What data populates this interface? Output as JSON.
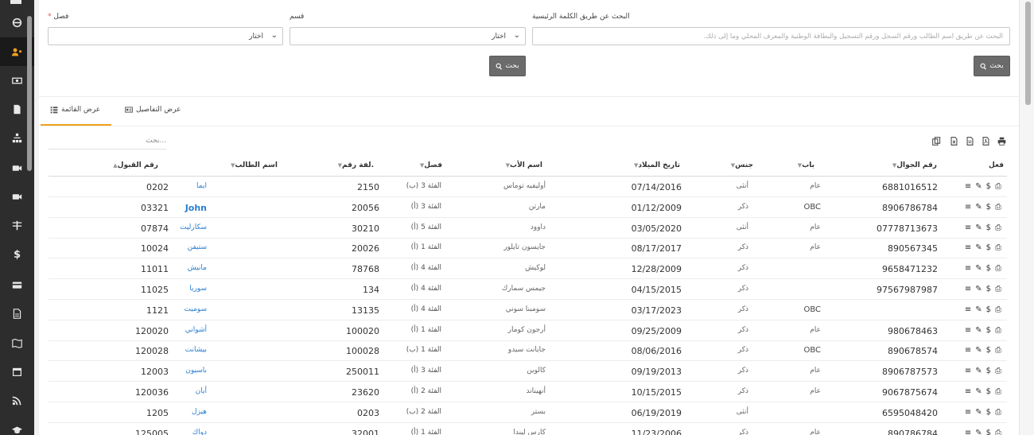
{
  "filters": {
    "class_label": "فصل",
    "required_mark": "*",
    "class_select": "اختار",
    "section_label": "قسم",
    "section_select": "اختار",
    "keyword_label": "البحث عن طريق الكلمة الرئيسية",
    "keyword_placeholder": "البحث عن طريق اسم الطالب ورقم السجل ورقم التسجيل والبطاقة الوطنية والمعرف المحلي وما إلى ذلك.",
    "search_button": "بحث"
  },
  "tabs": [
    {
      "label": "عرض القائمة",
      "icon": "list-icon",
      "active": true
    },
    {
      "label": "عرض التفاصيل",
      "icon": "id-card-icon",
      "active": false
    }
  ],
  "table_search_placeholder": "بحث...",
  "toolbar_icons": [
    "print-icon",
    "pdf-icon",
    "csv-icon",
    "excel-icon",
    "copy-icon"
  ],
  "columns": [
    "فعل",
    "رقم الجوال",
    "باب",
    "جنس",
    "تاريخ الميلاد",
    "اسم الأب",
    "فصل",
    "لفة رقم.",
    "اسم الطالب",
    "رقم القبول"
  ],
  "action_glyphs": {
    "menu": "≡",
    "edit": "✎",
    "fees": "$",
    "print": "⎙"
  },
  "rows": [
    {
      "mobile": "6881016512",
      "section": "عام",
      "gender": "أنثى",
      "dob": "07/14/2016",
      "father": "أوليفيه توماس",
      "class": "الفئة 3 (ب)",
      "roll": "2150",
      "name": "ايما",
      "admission": "0202"
    },
    {
      "mobile": "8906786784",
      "section": "OBC",
      "gender": "ذكر",
      "dob": "01/12/2009",
      "father": "مارتن",
      "class": "الفئة 3 (أ)",
      "roll": "20056",
      "name": "John",
      "admission": "03321"
    },
    {
      "mobile": "07778713673",
      "section": "عام",
      "gender": "أنثى",
      "dob": "03/05/2020",
      "father": "داوود",
      "class": "الفئة 5 (أ)",
      "roll": "30210",
      "name": "سكارليت",
      "admission": "07874"
    },
    {
      "mobile": "890567345",
      "section": "عام",
      "gender": "ذكر",
      "dob": "08/17/2017",
      "father": "جايسون تايلور",
      "class": "الفئة 1 (أ)",
      "roll": "20026",
      "name": "ستيفن",
      "admission": "10024"
    },
    {
      "mobile": "9658471232",
      "section": "",
      "gender": "ذكر",
      "dob": "12/28/2009",
      "father": "لوكيش",
      "class": "الفئة 4 (أ)",
      "roll": "78768",
      "name": "مانيش",
      "admission": "11011"
    },
    {
      "mobile": "97567987987",
      "section": "",
      "gender": "ذكر",
      "dob": "04/15/2015",
      "father": "جيمس سمارك",
      "class": "الفئة 4 (أ)",
      "roll": "134",
      "name": "سوريا",
      "admission": "11025"
    },
    {
      "mobile": "",
      "section": "OBC",
      "gender": "ذكر",
      "dob": "03/17/2023",
      "father": "سومبنا سوني",
      "class": "الفئة 4 (أ)",
      "roll": "13135",
      "name": "سوميت",
      "admission": "1121"
    },
    {
      "mobile": "980678463",
      "section": "عام",
      "gender": "ذكر",
      "dob": "09/25/2009",
      "father": "أرجون كومار",
      "class": "الفئة 1 (أ)",
      "roll": "100020",
      "name": "أشواني",
      "admission": "120020"
    },
    {
      "mobile": "890678574",
      "section": "OBC",
      "gender": "ذكر",
      "dob": "08/06/2016",
      "father": "جايانت سيدو",
      "class": "الفئة 1 (ب)",
      "roll": "100028",
      "name": "بيشانت",
      "admission": "120028"
    },
    {
      "mobile": "8906787573",
      "section": "عام",
      "gender": "ذكر",
      "dob": "09/19/2013",
      "father": "كالوين",
      "class": "الفئة 3 (أ)",
      "roll": "250011",
      "name": "باسيون",
      "admission": "12003"
    },
    {
      "mobile": "9067875674",
      "section": "عام",
      "gender": "ذكر",
      "dob": "10/15/2015",
      "father": "أنهيناند",
      "class": "الفئة 2 (أ)",
      "roll": "23620",
      "name": "أيان",
      "admission": "120036"
    },
    {
      "mobile": "6595048420",
      "section": "",
      "gender": "أنثى",
      "dob": "06/19/2019",
      "father": "بستر",
      "class": "الفئة 2 (ب)",
      "roll": "0203",
      "name": "هيزل",
      "admission": "1205"
    },
    {
      "mobile": "890786784",
      "section": "عام",
      "gender": "ذكر",
      "dob": "11/23/2006",
      "father": "كارس ليندا",
      "class": "الفئة 1 (أ)",
      "roll": "32001",
      "name": "دواك",
      "admission": "125005"
    }
  ],
  "sidebar_icons": [
    "bars-icon",
    "gauge-icon",
    "user-group-icon",
    "money-icon",
    "document-icon",
    "sitemap-icon",
    "video-icon",
    "video-icon",
    "filter-icon",
    "dollar-icon",
    "credit-card-icon",
    "file-icon",
    "map-icon",
    "calendar-icon",
    "rss-icon",
    "graduation-cap-icon"
  ]
}
